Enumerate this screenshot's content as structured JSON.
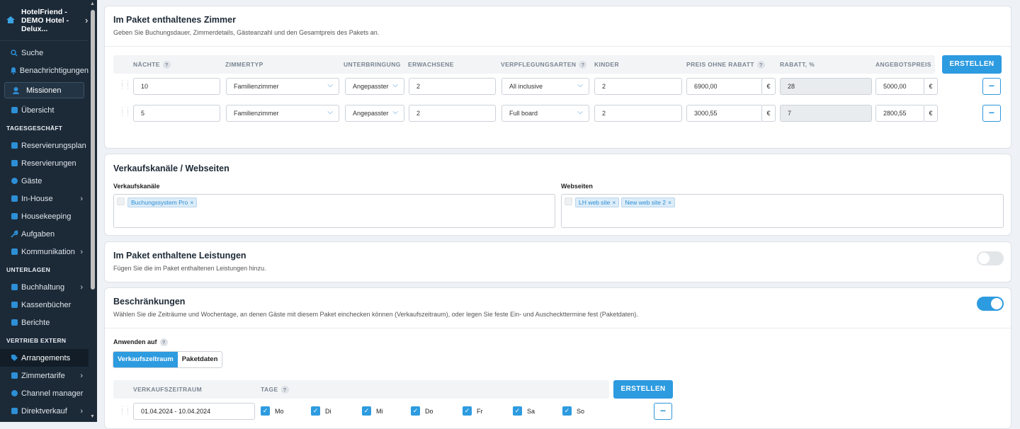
{
  "sidebar": {
    "hotel_name": "HotelFriend - DEMO Hotel - Delux...",
    "items": [
      {
        "label": "Suche",
        "icon": "search-icon"
      },
      {
        "label": "Benachrichtigungen",
        "icon": "bell-icon"
      },
      {
        "label": "Missionen",
        "icon": "missions-icon"
      },
      {
        "label": "Übersicht",
        "icon": "dashboard-icon"
      },
      {
        "label": "TAGESGESCHÄFT"
      },
      {
        "label": "Reservierungsplan",
        "icon": "calendar-icon"
      },
      {
        "label": "Reservierungen",
        "icon": "reservations-icon"
      },
      {
        "label": "Gäste",
        "icon": "guests-icon"
      },
      {
        "label": "In-House",
        "icon": "inhouse-icon"
      },
      {
        "label": "Housekeeping",
        "icon": "housekeeping-icon"
      },
      {
        "label": "Aufgaben",
        "icon": "wrench-icon"
      },
      {
        "label": "Kommunikation",
        "icon": "chat-icon"
      },
      {
        "label": "UNTERLAGEN"
      },
      {
        "label": "Buchhaltung",
        "icon": "accounting-icon"
      },
      {
        "label": "Kassenbücher",
        "icon": "cashbook-icon"
      },
      {
        "label": "Berichte",
        "icon": "reports-icon"
      },
      {
        "label": "VERTRIEB EXTERN"
      },
      {
        "label": "Arrangements",
        "icon": "tag-icon"
      },
      {
        "label": "Zimmertarife",
        "icon": "chart-icon"
      },
      {
        "label": "Channel manager",
        "icon": "channel-icon"
      },
      {
        "label": "Direktverkauf",
        "icon": "shop-icon"
      }
    ]
  },
  "rooms": {
    "title": "Im Paket enthaltenes Zimmer",
    "subtitle": "Geben Sie Buchungsdauer, Zimmerdetails, Gästeanzahl und den Gesamtpreis des Pakets an.",
    "columns": [
      "NÄCHTE",
      "ZIMMERTYP",
      "UNTERBRINGUNG",
      "ERWACHSENE",
      "VERPFLEGUNGSARTEN",
      "KINDER",
      "PREIS OHNE RABATT",
      "RABATT, %",
      "ANGEBOTSPREIS"
    ],
    "help": "?",
    "create_label": "ERSTELLEN",
    "currency": "€",
    "minus": "−",
    "rows": [
      {
        "nights": "10",
        "room_type": "Familienzimmer",
        "accommodation": "Angepasster",
        "adults": "2",
        "meal": "All inclusive",
        "children": "2",
        "price": "6900,00",
        "discount": "28",
        "offer": "5000,00"
      },
      {
        "nights": "5",
        "room_type": "Familienzimmer",
        "accommodation": "Angepasster",
        "adults": "2",
        "meal": "Full board",
        "children": "2",
        "price": "3000,55",
        "discount": "7",
        "offer": "2800,55"
      }
    ]
  },
  "channels": {
    "title": "Verkaufskanäle / Webseiten",
    "sales_label": "Verkaufskanäle",
    "sales_tags": [
      "Buchungssystem Pro"
    ],
    "web_label": "Webseiten",
    "web_tags": [
      "LH web site",
      "New web site 2"
    ],
    "tag_remove": "×"
  },
  "services": {
    "title": "Im Paket enthaltene Leistungen",
    "subtitle": "Fügen Sie die im Paket enthaltenen Leistungen hinzu.",
    "enabled": false
  },
  "restrictions": {
    "title": "Beschränkungen",
    "subtitle": "Wählen Sie die Zeiträume und Wochentage, an denen Gäste mit diesem Paket einchecken können (Verkaufszeitraum), oder legen Sie feste Ein- und Auscheckttermine fest (Paketdaten).",
    "enabled": true,
    "apply_label": "Anwenden auf",
    "tab_on": "Verkaufszeitraum",
    "tab_off": "Paketdaten",
    "col_period": "VERKAUFSZEITRAUM",
    "col_days": "TAGE",
    "create_label": "ERSTELLEN",
    "period": "01.04.2024 - 10.04.2024",
    "days": [
      "Mo",
      "Di",
      "Mi",
      "Do",
      "Fr",
      "Sa",
      "So"
    ],
    "minus": "−"
  },
  "colors": {
    "accent": "#2d9be0",
    "sidebar_bg": "#1c2a38"
  }
}
